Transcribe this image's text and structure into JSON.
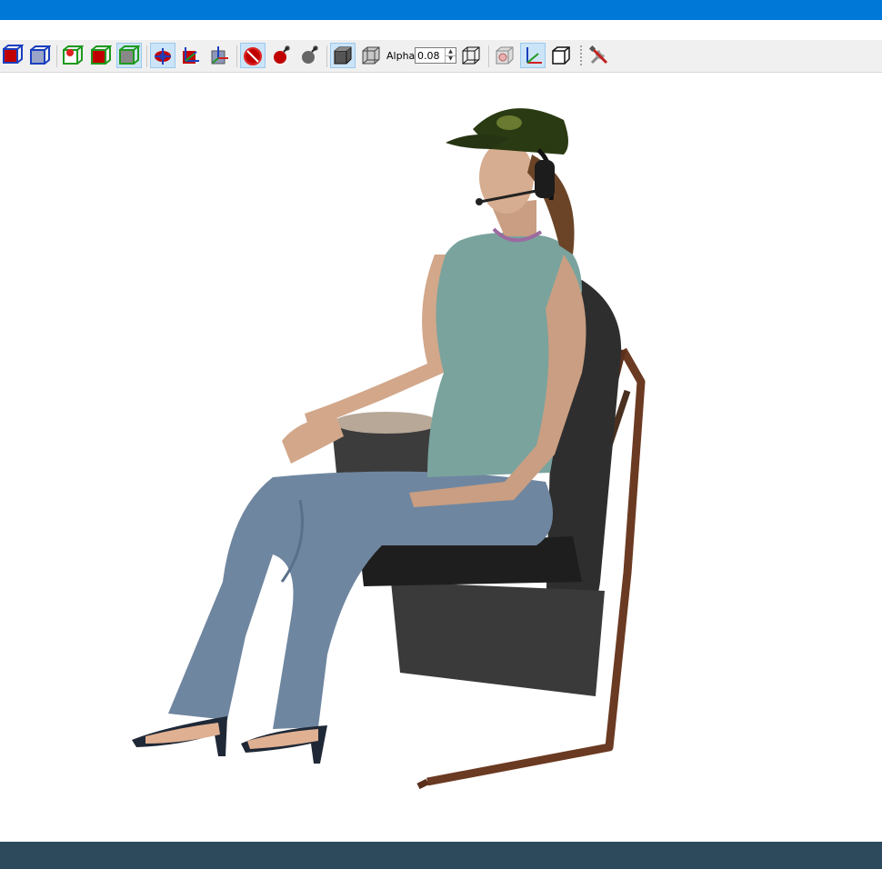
{
  "window": {
    "title_bar_color": "#0078d7",
    "status_bar_color": "#2d4a5d"
  },
  "toolbar": {
    "buttons": [
      {
        "name": "solid-red-box-icon"
      },
      {
        "name": "wire-blue-box-icon"
      },
      {
        "name": "collision-box-icon"
      },
      {
        "name": "filled-green-box-icon"
      },
      {
        "name": "gray-green-box-icon",
        "active": true
      },
      {
        "name": "center-of-mass-icon",
        "active": true
      },
      {
        "name": "frames-icon"
      },
      {
        "name": "axes-box-icon"
      },
      {
        "name": "no-bomb-icon",
        "active": true
      },
      {
        "name": "bomb-icon"
      },
      {
        "name": "gray-bomb-icon"
      },
      {
        "name": "solid-cube-icon",
        "active": true
      },
      {
        "name": "transparent-cube-icon"
      },
      {
        "name": "wireframe-cube-icon"
      },
      {
        "name": "textured-cube-icon"
      },
      {
        "name": "world-axes-icon",
        "active": true
      },
      {
        "name": "outline-cube-icon"
      },
      {
        "name": "tools-icon"
      }
    ],
    "alpha": {
      "label": "Alpha:",
      "value": "0.08"
    }
  },
  "viewport": {
    "scene_description_icon": "seated-woman-model"
  }
}
